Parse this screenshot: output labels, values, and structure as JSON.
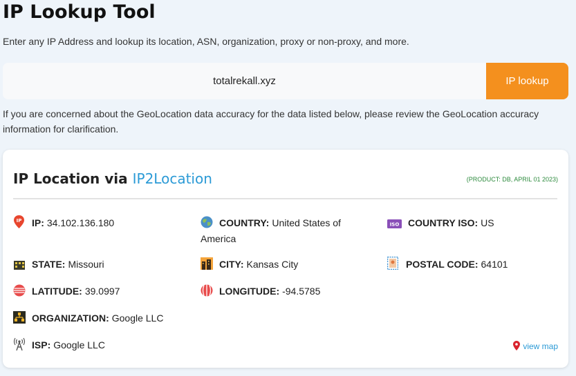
{
  "page": {
    "title": "IP Lookup Tool",
    "intro": "Enter any IP Address and lookup its location, ASN, organization, proxy or non-proxy, and more."
  },
  "search": {
    "value": "totalrekall.xyz",
    "button_label": "IP lookup"
  },
  "accuracy_note": "If you are concerned about the GeoLocation data accuracy for the data listed below, please review the GeoLocation accuracy information for clarification.",
  "card": {
    "title_prefix": "IP Location via ",
    "provider": "IP2Location",
    "product_info": "(PRODUCT: DB, APRIL 01 2023)",
    "view_map": "view map",
    "fields": {
      "ip": {
        "label": "IP:",
        "value": "34.102.136.180",
        "icon": "ip-pin-icon"
      },
      "country": {
        "label": "COUNTRY:",
        "value": "United States of America",
        "icon": "globe-icon"
      },
      "country_iso": {
        "label": "COUNTRY ISO:",
        "value": "US",
        "icon": "iso-badge-icon"
      },
      "state": {
        "label": "STATE:",
        "value": "Missouri",
        "icon": "state-building-icon"
      },
      "city": {
        "label": "CITY:",
        "value": "Kansas City",
        "icon": "city-icon"
      },
      "postal_code": {
        "label": "POSTAL CODE:",
        "value": "64101",
        "icon": "stamp-icon"
      },
      "latitude": {
        "label": "LATITUDE:",
        "value": "39.0997",
        "icon": "latitude-globe-icon"
      },
      "longitude": {
        "label": "LONGITUDE:",
        "value": "-94.5785",
        "icon": "longitude-globe-icon"
      },
      "organization": {
        "label": "ORGANIZATION:",
        "value": "Google LLC",
        "icon": "organization-icon"
      },
      "isp": {
        "label": "ISP:",
        "value": "Google LLC",
        "icon": "antenna-icon"
      }
    }
  },
  "colors": {
    "accent_orange": "#f4901e",
    "link_blue": "#2b9ad6",
    "product_green": "#2e8b3e",
    "background": "#eef4fa"
  }
}
